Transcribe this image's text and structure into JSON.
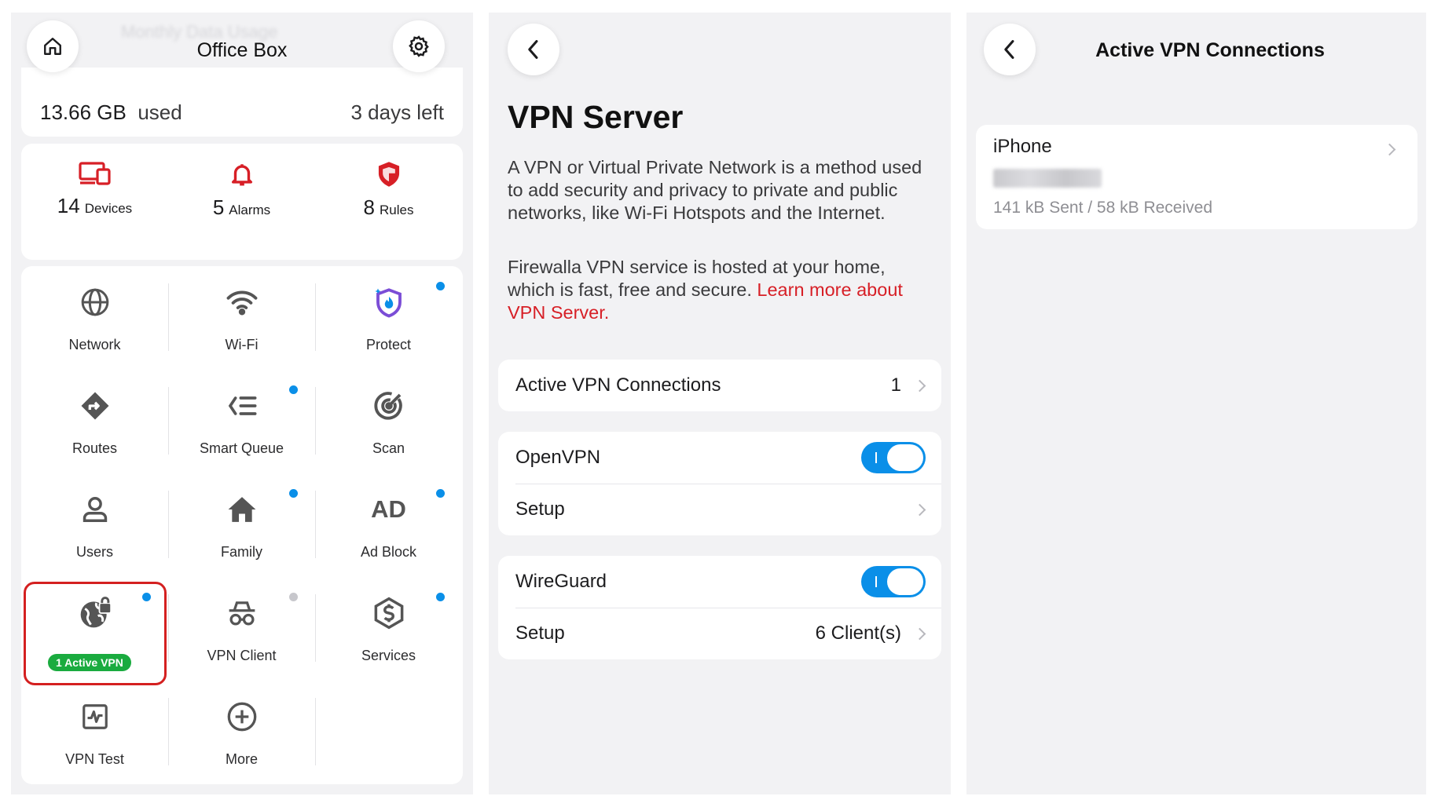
{
  "panel1": {
    "ghost_text": "Monthly Data Usage",
    "device_name": "Office Box",
    "usage": {
      "amount": "13.66 GB",
      "unit_label": "used",
      "days_left": "3 days left"
    },
    "stats": [
      {
        "count": "14",
        "label": "Devices",
        "icon": "devices-icon"
      },
      {
        "count": "5",
        "label": "Alarms",
        "icon": "bell-icon"
      },
      {
        "count": "8",
        "label": "Rules",
        "icon": "shield-icon"
      }
    ],
    "tiles": [
      {
        "label": "Network",
        "icon": "globe-icon",
        "dot": "none"
      },
      {
        "label": "Wi-Fi",
        "icon": "wifi-icon",
        "dot": "none"
      },
      {
        "label": "Protect",
        "icon": "protect-icon",
        "dot": "blue"
      },
      {
        "label": "Routes",
        "icon": "route-icon",
        "dot": "none"
      },
      {
        "label": "Smart Queue",
        "icon": "queue-icon",
        "dot": "blue"
      },
      {
        "label": "Scan",
        "icon": "radar-icon",
        "dot": "none"
      },
      {
        "label": "Users",
        "icon": "user-icon",
        "dot": "none"
      },
      {
        "label": "Family",
        "icon": "home-icon",
        "dot": "blue"
      },
      {
        "label": "Ad Block",
        "icon": "ad-icon",
        "dot": "blue",
        "glyph": "AD"
      },
      {
        "label": "1 Active VPN",
        "icon": "vpn-globe-lock-icon",
        "dot": "blue"
      },
      {
        "label": "VPN Client",
        "icon": "spy-icon",
        "dot": "grey"
      },
      {
        "label": "Services",
        "icon": "services-icon",
        "dot": "blue"
      },
      {
        "label": "VPN Test",
        "icon": "pulse-icon",
        "dot": "none"
      },
      {
        "label": "More",
        "icon": "plus-circle-icon",
        "dot": "none"
      }
    ],
    "colors": {
      "accent_red": "#d71f26",
      "dot_blue": "#0a8fe8",
      "vpn_badge_green": "#1aab3f"
    }
  },
  "panel2": {
    "title": "VPN Server",
    "intro": "A VPN or Virtual Private Network is a method used to add security and privacy to private and public networks, like Wi-Fi Hotspots and the Internet.",
    "hosted_text": "Firewalla VPN service is hosted at your home, which is fast, free and secure.",
    "learn_more": "Learn more about VPN Server.",
    "active_connections": {
      "label": "Active VPN Connections",
      "count": "1"
    },
    "openvpn": {
      "label": "OpenVPN",
      "enabled": true,
      "setup_label": "Setup"
    },
    "wireguard": {
      "label": "WireGuard",
      "enabled": true,
      "setup_label": "Setup",
      "clients": "6 Client(s)"
    }
  },
  "panel3": {
    "title": "Active VPN Connections",
    "connection": {
      "name": "iPhone",
      "traffic": "141 kB Sent  / 58 kB Received"
    }
  }
}
